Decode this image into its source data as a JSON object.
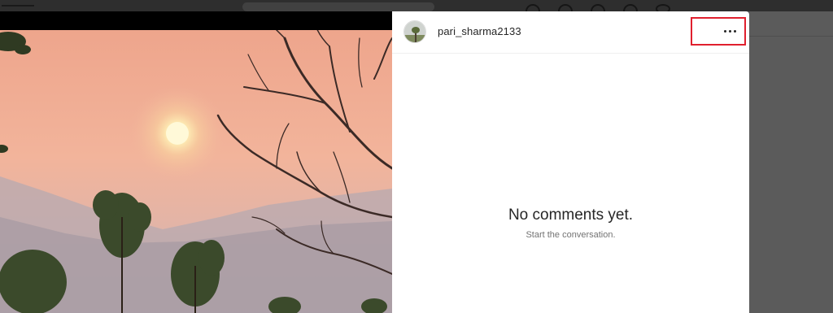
{
  "post": {
    "username": "pari_sharma2133",
    "more_options_icon": "more-horizontal-icon",
    "photo_description_icon": "sunset-photo"
  },
  "comments": {
    "empty_title": "No comments yet.",
    "empty_subtitle": "Start the conversation."
  },
  "colors": {
    "highlight_border": "#e0202e",
    "sky_top": "#f1a98e",
    "sun": "#fff7c9"
  }
}
